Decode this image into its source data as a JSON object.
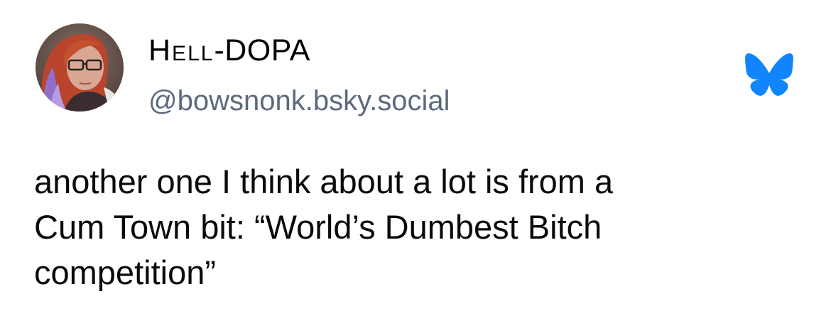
{
  "post": {
    "author": {
      "display_name_prefix": "Hell",
      "display_name_suffix": "-DOPA",
      "handle": "@bowsnonk.bsky.social",
      "avatar": "profile-photo"
    },
    "platform_icon": "bluesky-butterfly-icon",
    "brand_color": "#1185fe",
    "handle_color": "#5b6b7d",
    "text_lines": [
      "another one I think about a lot is from a",
      "Cum Town bit: “World’s Dumbest Bitch",
      "competition”"
    ]
  }
}
